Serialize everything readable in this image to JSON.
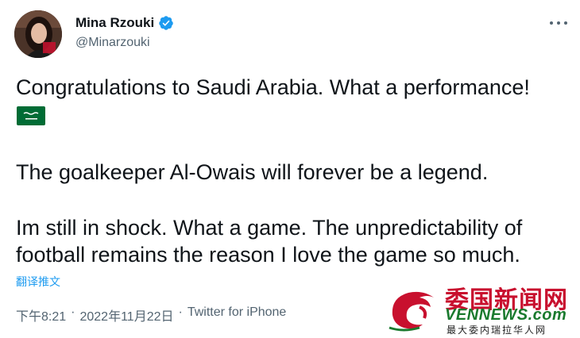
{
  "author": {
    "name": "Mina Rzouki",
    "handle": "@Minarzouki",
    "verified": true,
    "avatar_icon": "profile-photo"
  },
  "tweet": {
    "line1": "Congratulations to Saudi Arabia. What a performance!",
    "flag_icon": "saudi-arabia-flag",
    "line2": "The goalkeeper Al-Owais will forever be a legend.",
    "line3": "Im still in shock. What a game. The unpredictability of\nfootball remains the reason I love the game so much."
  },
  "translate_label": "翻译推文",
  "meta": {
    "time": "下午8:21",
    "separator": "·",
    "date": "2022年11月22日",
    "source": "Twitter for iPhone"
  },
  "watermark": {
    "title": "委国新闻网",
    "url": "VENNEWS.com",
    "subtitle": "最大委内瑞拉华人网"
  },
  "colors": {
    "accent": "#1d9bf0",
    "secondary_text": "#536471",
    "flag_green": "#006c35"
  }
}
